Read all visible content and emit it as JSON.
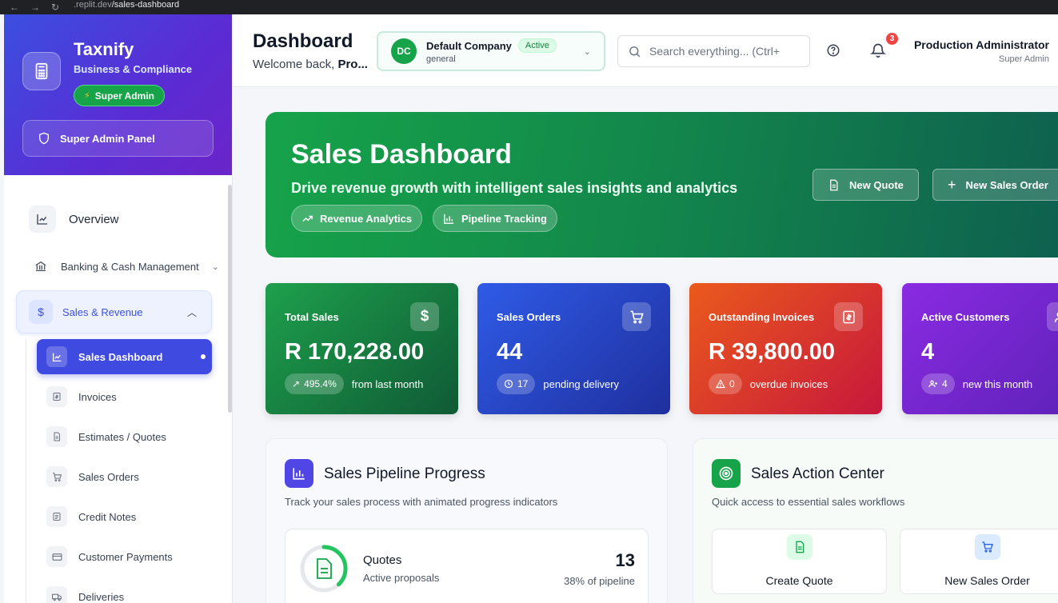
{
  "browser": {
    "url_prefix": ".replit.dev",
    "url_path": "/sales-dashboard"
  },
  "sidebar": {
    "brand_name": "Taxnify",
    "brand_subtitle": "Business & Compliance",
    "super_badge": "Super Admin",
    "admin_panel": "Super Admin Panel",
    "overview": "Overview",
    "banking": "Banking & Cash Management",
    "sales_revenue": "Sales & Revenue",
    "sub_items": [
      {
        "label": "Sales Dashboard",
        "icon": "line-chart-icon"
      },
      {
        "label": "Invoices",
        "icon": "invoice-icon"
      },
      {
        "label": "Estimates / Quotes",
        "icon": "document-icon"
      },
      {
        "label": "Sales Orders",
        "icon": "cart-icon"
      },
      {
        "label": "Credit Notes",
        "icon": "credit-note-icon"
      },
      {
        "label": "Customer Payments",
        "icon": "card-icon"
      },
      {
        "label": "Deliveries",
        "icon": "truck-icon"
      }
    ]
  },
  "header": {
    "title": "Dashboard",
    "welcome_prefix": "Welcome back, ",
    "welcome_name": "Pro...",
    "company_initials": "DC",
    "company_name": "Default Company",
    "company_status": "Active",
    "company_type": "general",
    "search_placeholder": "Search everything... (Ctrl+",
    "notification_count": "3",
    "user_name": "Production Administrator",
    "user_role": "Super Admin"
  },
  "hero": {
    "title": "Sales Dashboard",
    "subtitle": "Drive revenue growth with intelligent sales insights and analytics",
    "chip_1": "Revenue Analytics",
    "chip_2": "Pipeline Tracking",
    "btn_quote": "New Quote",
    "btn_order": "New Sales Order"
  },
  "stats": [
    {
      "label": "Total Sales",
      "value": "R 170,228.00",
      "pill": "495.4%",
      "foot": "from last month",
      "color_start": "#1ea04c",
      "color_end": "#0f5a35"
    },
    {
      "label": "Sales Orders",
      "value": "44",
      "pill": "17",
      "foot": "pending delivery",
      "color_start": "#2f5be7",
      "color_end": "#1f2f9e"
    },
    {
      "label": "Outstanding Invoices",
      "value": "R 39,800.00",
      "pill": "0",
      "foot": "overdue invoices",
      "color_start": "#ea5a1c",
      "color_end": "#c7173c"
    },
    {
      "label": "Active Customers",
      "value": "4",
      "pill": "4",
      "foot": "new this month",
      "color_start": "#8a2be2",
      "color_end": "#5b21b6"
    }
  ],
  "pipeline": {
    "title": "Sales Pipeline Progress",
    "subtitle": "Track your sales process with animated progress indicators",
    "quote_title": "Quotes",
    "quote_sub": "Active proposals",
    "quote_count": "13",
    "quote_pct_label": "38% of pipeline",
    "quote_fraction": 0.38
  },
  "actions": {
    "title": "Sales Action Center",
    "subtitle": "Quick access to essential sales workflows",
    "create_quote": "Create Quote",
    "new_sales_order": "New Sales Order"
  }
}
